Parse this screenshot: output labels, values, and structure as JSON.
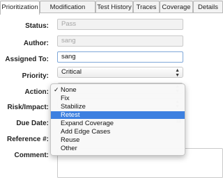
{
  "tabs": [
    {
      "label": "Prioritization",
      "active": true
    },
    {
      "label": "Modification History",
      "active": false
    },
    {
      "label": "Test History",
      "active": false
    },
    {
      "label": "Traces",
      "active": false
    },
    {
      "label": "Coverage",
      "active": false
    },
    {
      "label": "Details",
      "active": false
    }
  ],
  "form": {
    "status": {
      "label": "Status:",
      "value": "Pass"
    },
    "author": {
      "label": "Author:",
      "value": "sang"
    },
    "assigned_to": {
      "label": "Assigned To:",
      "value": "sang"
    },
    "priority": {
      "label": "Priority:",
      "value": "Critical"
    },
    "action": {
      "label": "Action:",
      "value": "None"
    },
    "risk_impact": {
      "label": "Risk/Impact:"
    },
    "due_date": {
      "label": "Due Date:"
    },
    "reference": {
      "label": "Reference #:"
    },
    "comment": {
      "label": "Comment:"
    }
  },
  "action_menu": {
    "selected": "None",
    "highlighted": "Retest",
    "options": [
      "None",
      "Fix",
      "Stabilize",
      "Retest",
      "Expand Coverage",
      "Add Edge Cases",
      "Reuse",
      "Other"
    ]
  },
  "colors": {
    "highlight": "#3d80e0"
  }
}
